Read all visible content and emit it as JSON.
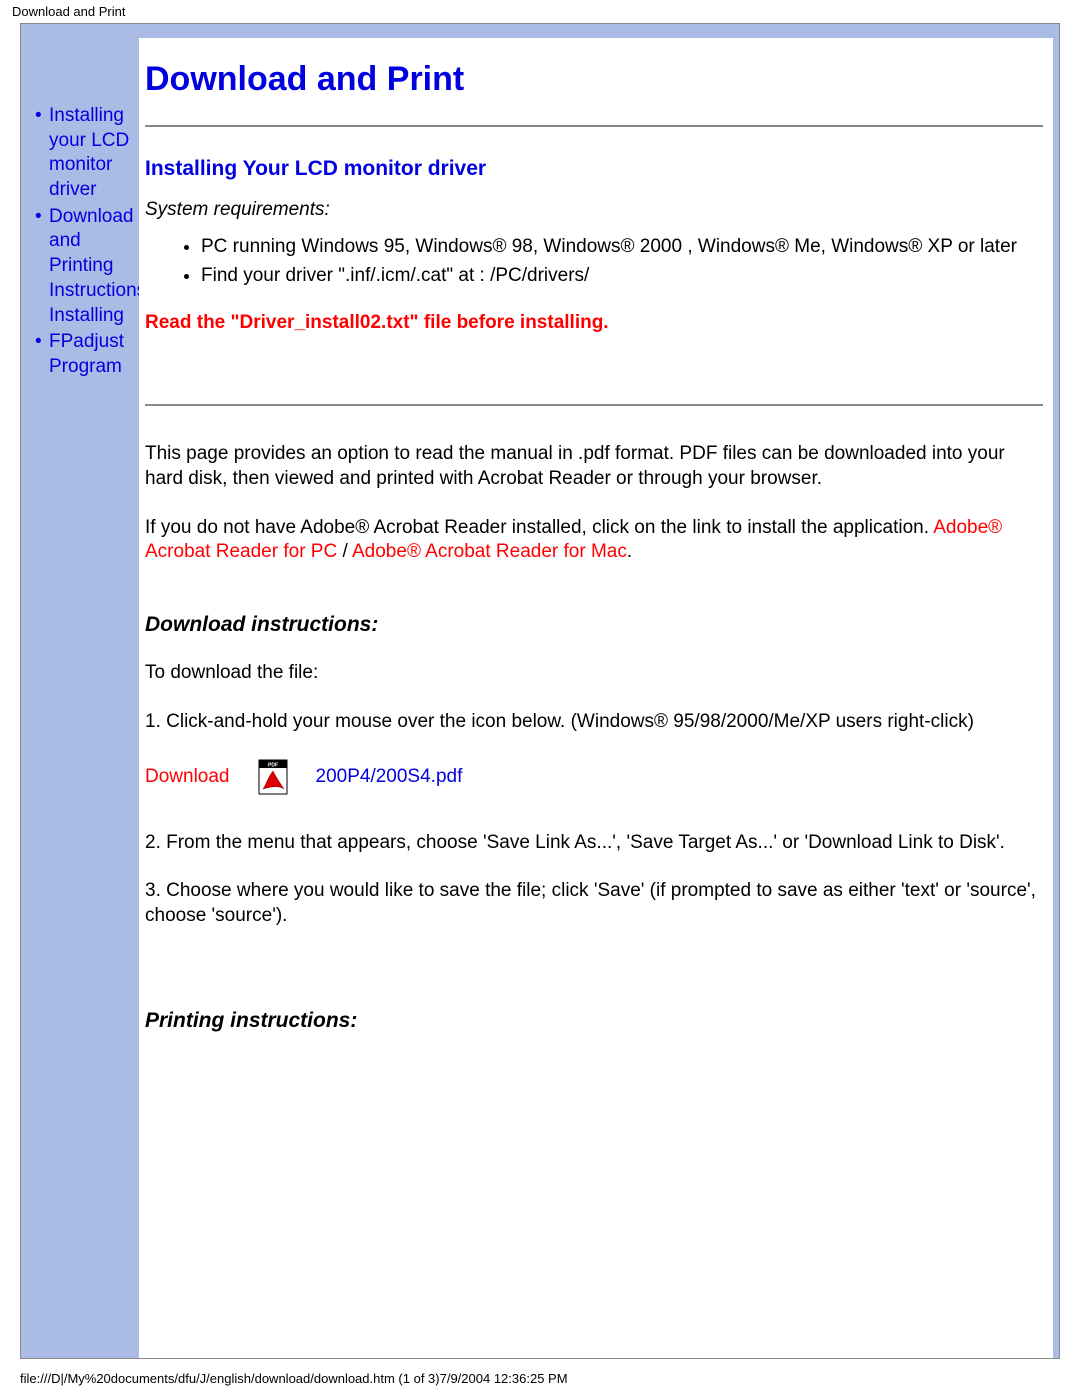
{
  "header_title": "Download and Print",
  "sidebar": {
    "items": [
      {
        "label": "Installing your LCD monitor driver"
      },
      {
        "label": "Download and Printing Instructions Installing"
      },
      {
        "label": "FPadjust Program"
      }
    ]
  },
  "page_heading": "Download and Print",
  "section1": {
    "heading": "Installing Your LCD monitor driver",
    "sysreq_label": "System requirements:",
    "req1": "PC running Windows 95, Windows® 98, Windows® 2000 , Windows® Me, Windows® XP or later",
    "req2": "Find your driver \".inf/.icm/.cat\" at : /PC/drivers/",
    "warning": "Read the \"Driver_install02.txt\" file before installing."
  },
  "intro": {
    "para1": "This page provides an option to read the manual in .pdf format. PDF files can be downloaded into your hard disk, then viewed and printed with Acrobat Reader or through your browser.",
    "para2_prefix": "If you do not have Adobe® Acrobat Reader installed, click on the link to install the application. ",
    "link_pc": "Adobe® Acrobat Reader for PC",
    "separator": " / ",
    "link_mac": "Adobe® Acrobat Reader for Mac",
    "para2_suffix": "."
  },
  "download": {
    "heading": "Download instructions:",
    "intro": "To download the file:",
    "step1": "1. Click-and-hold your mouse over the icon below. (Windows® 95/98/2000/Me/XP users right-click)",
    "label": "Download",
    "filename": "200P4/200S4.pdf",
    "step2": "2. From the menu that appears, choose 'Save Link As...', 'Save Target As...' or 'Download Link to Disk'.",
    "step3": "3. Choose where you would like to save the file; click 'Save' (if prompted to save as either 'text' or 'source', choose 'source')."
  },
  "printing": {
    "heading": "Printing instructions:"
  },
  "footer_path": "file:///D|/My%20documents/dfu/J/english/download/download.htm (1 of 3)7/9/2004 12:36:25 PM"
}
